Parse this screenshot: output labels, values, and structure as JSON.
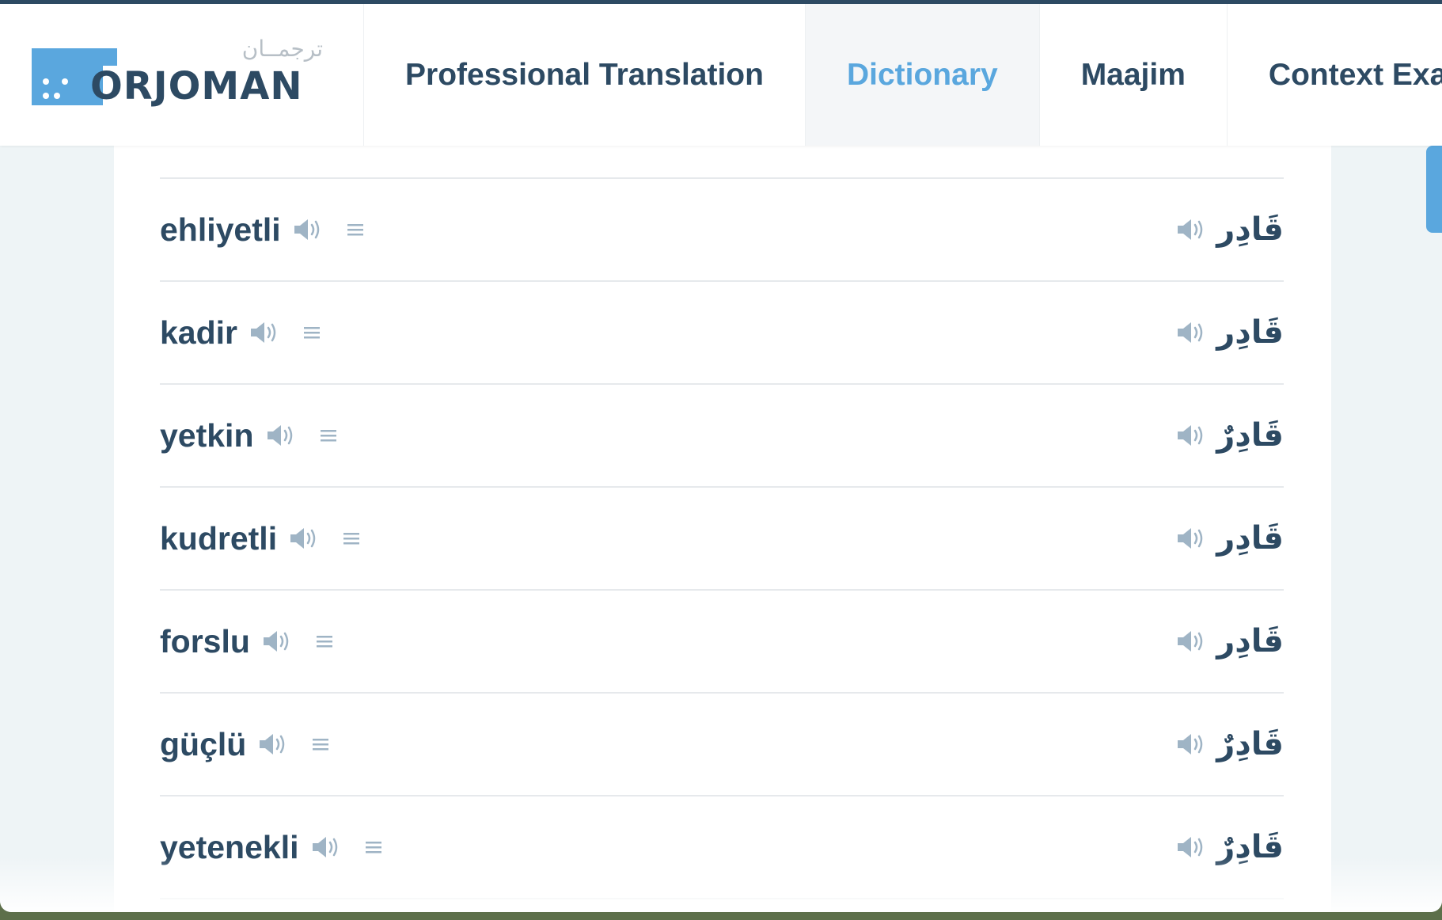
{
  "logo": {
    "text": "ORJOMAN",
    "arabic": "ترجمــان",
    "brand_color": "#5aa7de"
  },
  "nav": {
    "items": [
      {
        "label": "Professional Translation",
        "active": false
      },
      {
        "label": "Dictionary",
        "active": true
      },
      {
        "label": "Maajim",
        "active": false
      },
      {
        "label": "Context Exa",
        "active": false
      }
    ]
  },
  "entries": [
    {
      "word": "ehliyetli",
      "translation": "قَادِر"
    },
    {
      "word": "kadir",
      "translation": "قَادِر"
    },
    {
      "word": "yetkin",
      "translation": "قَادِرٌ"
    },
    {
      "word": "kudretli",
      "translation": "قَادِر"
    },
    {
      "word": "forslu",
      "translation": "قَادِر"
    },
    {
      "word": "güçlü",
      "translation": "قَادِرٌ"
    },
    {
      "word": "yetenekli",
      "translation": "قَادِرٌ"
    }
  ],
  "colors": {
    "text": "#2d4a63",
    "accent": "#5aa7de",
    "icon": "#9fb4c5",
    "divider": "#e6e9ec"
  },
  "icons": {
    "speaker": "speaker-icon",
    "menu": "menu-lines-icon"
  }
}
